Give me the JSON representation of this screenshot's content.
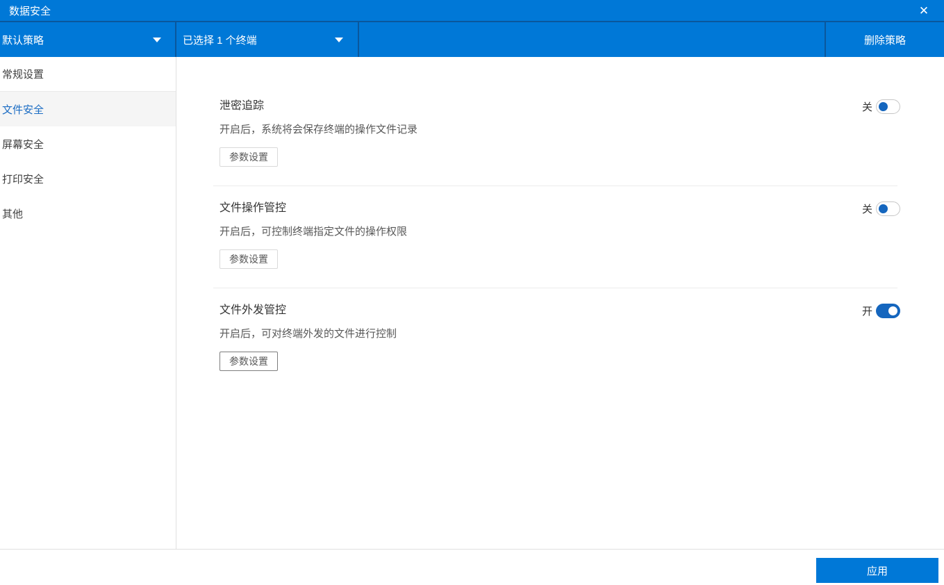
{
  "titlebar": {
    "title": "数据安全",
    "close_icon": "✕"
  },
  "toolbar": {
    "policy_dropdown": {
      "label": "默认策略"
    },
    "terminal_dropdown": {
      "label": "已选择 1 个终端"
    },
    "delete_button_label": "删除策略"
  },
  "sidebar": {
    "items": [
      {
        "label": "常规设置",
        "selected": false
      },
      {
        "label": "文件安全",
        "selected": true
      },
      {
        "label": "屏幕安全",
        "selected": false
      },
      {
        "label": "打印安全",
        "selected": false
      },
      {
        "label": "其他",
        "selected": false
      }
    ]
  },
  "main": {
    "sections": [
      {
        "title": "泄密追踪",
        "description": "开启后，系统将会保存终端的操作文件记录",
        "button": "参数设置",
        "toggle": {
          "state": "off",
          "label": "关"
        }
      },
      {
        "title": "文件操作管控",
        "description": "开启后，可控制终端指定文件的操作权限",
        "button": "参数设置",
        "toggle": {
          "state": "off",
          "label": "关"
        }
      },
      {
        "title": "文件外发管控",
        "description": "开启后，可对终端外发的文件进行控制",
        "button": "参数设置",
        "toggle": {
          "state": "on",
          "label": "开"
        }
      }
    ]
  },
  "footer": {
    "apply_label": "应用"
  },
  "colors": {
    "primary_blue": "#0078d7",
    "toolbar_divider_blue": "#0a579c",
    "toggle_blue": "#1566be",
    "selected_item_text": "#1a6cc4",
    "divider_gray": "#ececec"
  }
}
